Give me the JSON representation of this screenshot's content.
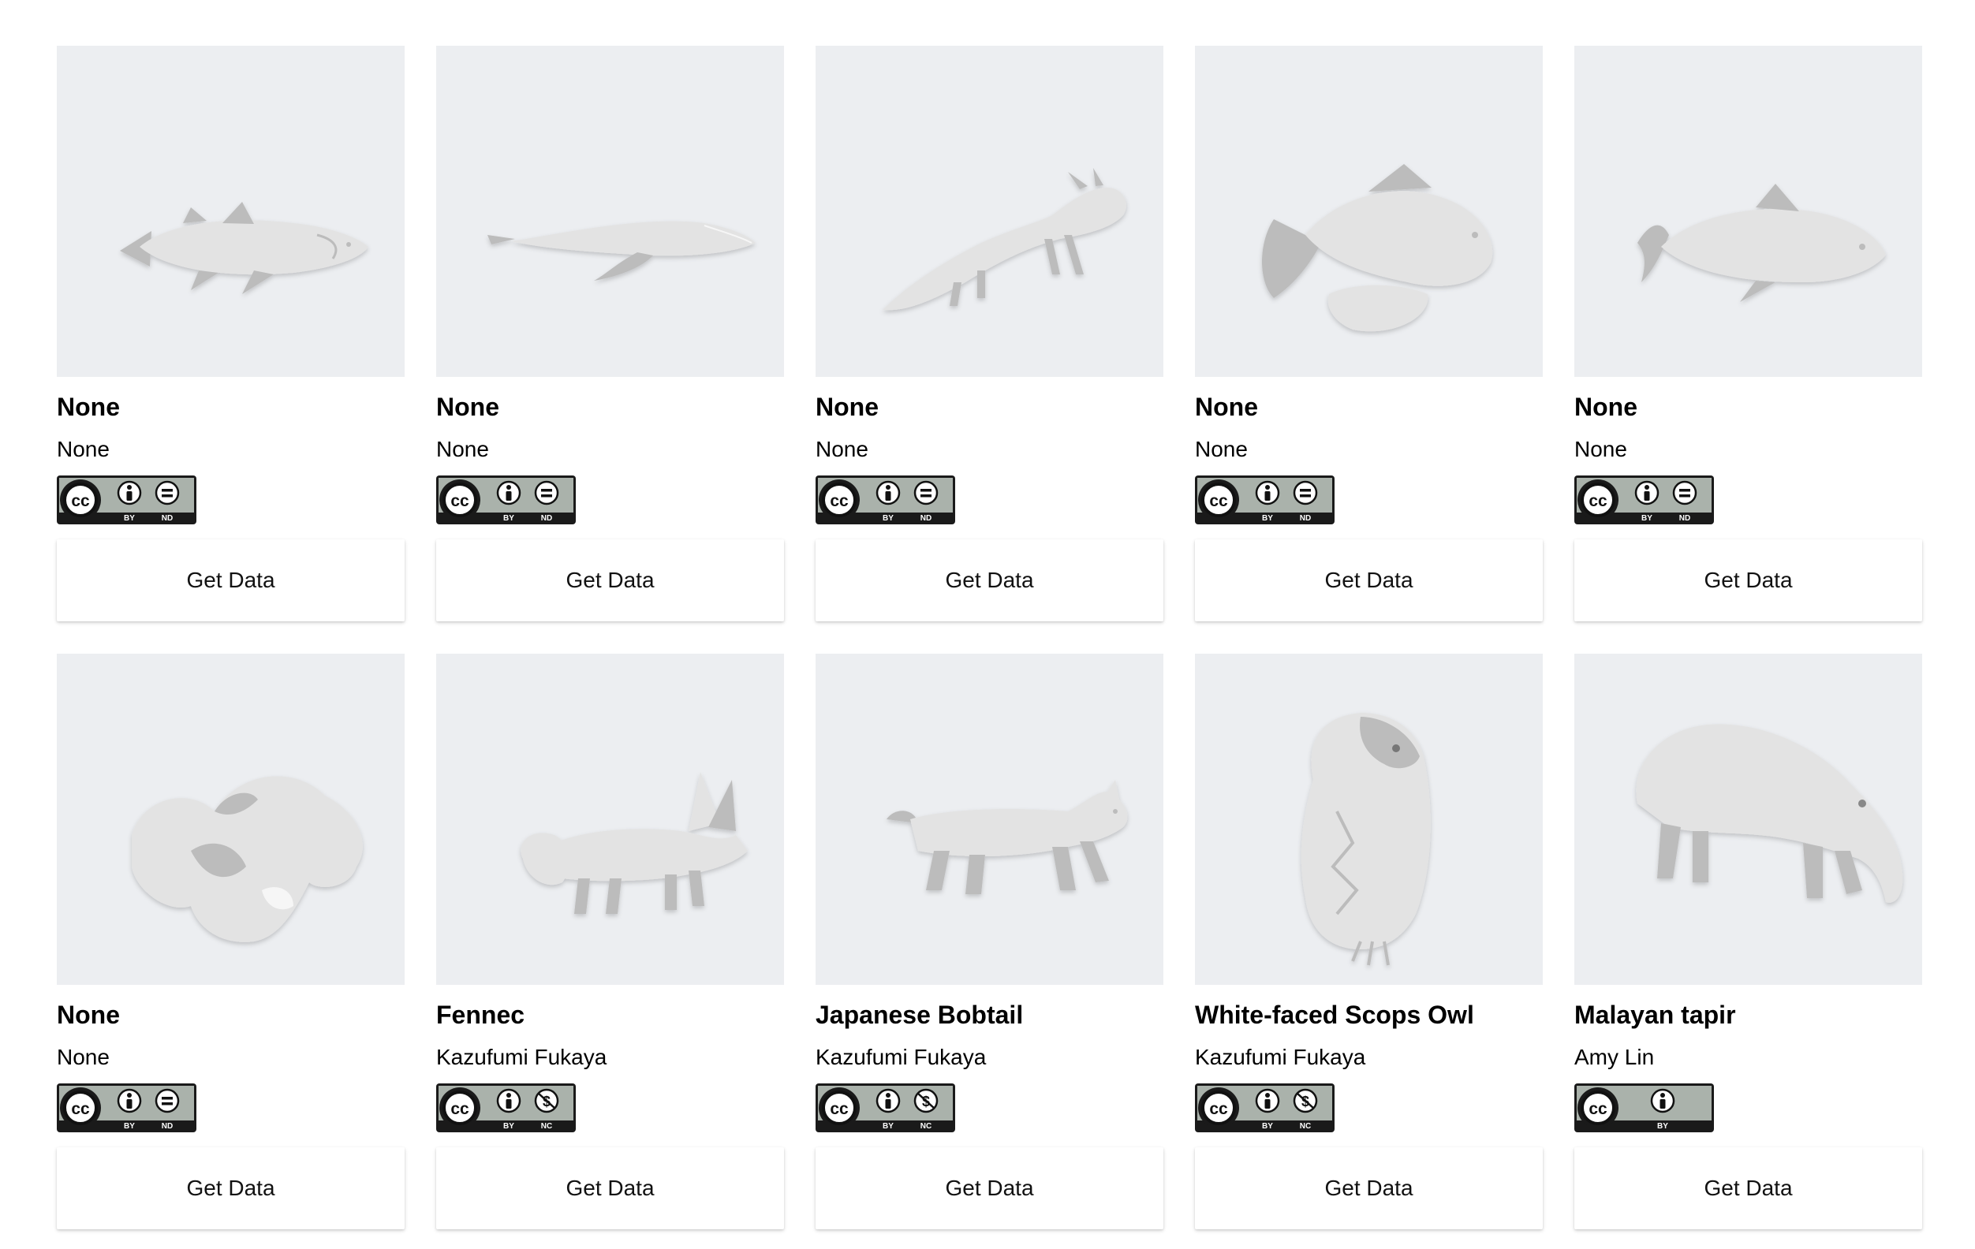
{
  "cards": [
    {
      "title": "None",
      "author": "None",
      "license": "cc-by-nd",
      "badge_labels": [
        "BY",
        "ND"
      ],
      "button_label": "Get Data",
      "model": "coelacanth"
    },
    {
      "title": "None",
      "author": "None",
      "license": "cc-by-nd",
      "badge_labels": [
        "BY",
        "ND"
      ],
      "button_label": "Get Data",
      "model": "whale"
    },
    {
      "title": "None",
      "author": "None",
      "license": "cc-by-nd",
      "badge_labels": [
        "BY",
        "ND"
      ],
      "button_label": "Get Data",
      "model": "axolotl"
    },
    {
      "title": "None",
      "author": "None",
      "license": "cc-by-nd",
      "badge_labels": [
        "BY",
        "ND"
      ],
      "button_label": "Get Data",
      "model": "goldfish"
    },
    {
      "title": "None",
      "author": "None",
      "license": "cc-by-nd",
      "badge_labels": [
        "BY",
        "ND"
      ],
      "button_label": "Get Data",
      "model": "fish"
    },
    {
      "title": "None",
      "author": "None",
      "license": "cc-by-nd",
      "badge_labels": [
        "BY",
        "ND"
      ],
      "button_label": "Get Data",
      "model": "blob"
    },
    {
      "title": "Fennec",
      "author": "Kazufumi Fukaya",
      "license": "cc-by-nc",
      "badge_labels": [
        "BY",
        "NC"
      ],
      "button_label": "Get Data",
      "model": "fennec"
    },
    {
      "title": "Japanese Bobtail",
      "author": "Kazufumi Fukaya",
      "license": "cc-by-nc",
      "badge_labels": [
        "BY",
        "NC"
      ],
      "button_label": "Get Data",
      "model": "cat"
    },
    {
      "title": "White-faced Scops Owl",
      "author": "Kazufumi Fukaya",
      "license": "cc-by-nc",
      "badge_labels": [
        "BY",
        "NC"
      ],
      "button_label": "Get Data",
      "model": "owl"
    },
    {
      "title": "Malayan tapir",
      "author": "Amy Lin",
      "license": "cc-by",
      "badge_labels": [
        "BY"
      ],
      "button_label": "Get Data",
      "model": "tapir"
    }
  ],
  "colors": {
    "thumb_bg": "#eceef1",
    "model_fill": "#e2e2e2",
    "model_shade": "#bdbdbd",
    "badge_dark": "#1a1a1a",
    "badge_grey": "#aab2ab"
  }
}
